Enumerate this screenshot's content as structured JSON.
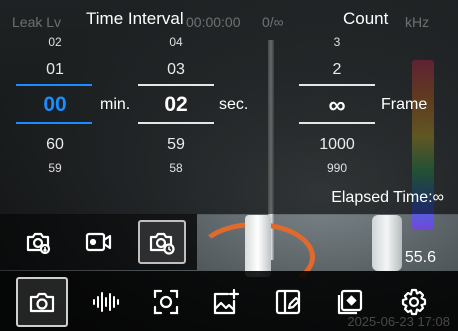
{
  "status_bar": {
    "leak_label": "Leak Lv",
    "timer": "00:00:00",
    "counter": "0/∞",
    "freq": "kHz"
  },
  "time_interval": {
    "title": "Time Interval",
    "minutes": {
      "items": [
        "02",
        "01",
        "00",
        "60",
        "59"
      ],
      "unit": "min."
    },
    "seconds": {
      "items": [
        "04",
        "03",
        "02",
        "59",
        "58"
      ],
      "unit": "sec."
    }
  },
  "count": {
    "title": "Count",
    "items": [
      "3",
      "2",
      "∞",
      "1000",
      "990"
    ],
    "unit": "Frame"
  },
  "elapsed": "Elapsed Time:∞",
  "reading": "55.6",
  "date_stamp": "2025-06-23  17:08",
  "mode_buttons": [
    {
      "icon": "camera-download-icon",
      "active": false
    },
    {
      "icon": "video-camera-icon",
      "active": false
    },
    {
      "icon": "camera-timer-icon",
      "active": true
    }
  ],
  "toolbar": [
    {
      "icon": "camera-icon",
      "active": true
    },
    {
      "icon": "sound-wave-icon",
      "active": false
    },
    {
      "icon": "focus-target-icon",
      "active": false
    },
    {
      "icon": "image-add-icon",
      "active": false
    },
    {
      "icon": "edit-compare-icon",
      "active": false
    },
    {
      "icon": "image-center-icon",
      "active": false
    },
    {
      "icon": "settings-icon",
      "active": false
    }
  ],
  "colors": {
    "accent": "#1a8cff",
    "cable": "#e06a2c"
  }
}
